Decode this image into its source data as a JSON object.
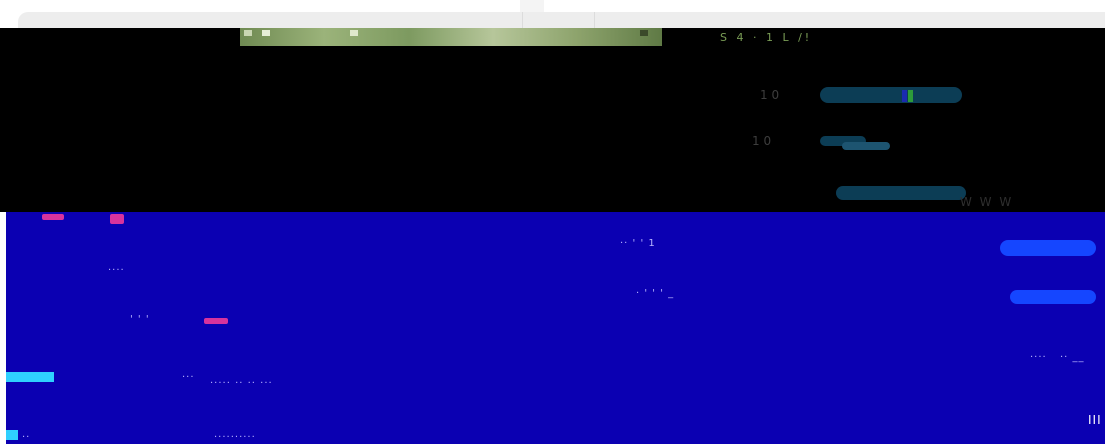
{
  "thumb_strip_text": "S 4 · 1 L /!",
  "rows": [
    {
      "title": "",
      "meta": "1 0",
      "tail": ""
    },
    {
      "title": "",
      "meta": "1 0",
      "tail": ""
    },
    {
      "title": "",
      "meta": "",
      "tail": "W W W"
    }
  ],
  "blue_noise": {
    "n1": "·· ' ' 1",
    "n2": "· ' ' ' _",
    "n3": "....",
    "n4": "' ' '",
    "n5": "···  ",
    "n6": "····· ·· ·· ···",
    "n7": "··········",
    "n8": "····",
    "n9": "··  __",
    "n10": "··"
  },
  "dialog": {
    "line1": "",
    "line2": "",
    "confirm_label": "",
    "cancel_label": "",
    "tail_text": "III"
  },
  "colors": {
    "dark_band": "#000000",
    "blue_area": "#0b00b2",
    "pill_dark": "#0c3d55",
    "pill_blue": "#1546ff",
    "accent_magenta": "#d7339d",
    "accent_cyan": "#2fd0ff"
  }
}
